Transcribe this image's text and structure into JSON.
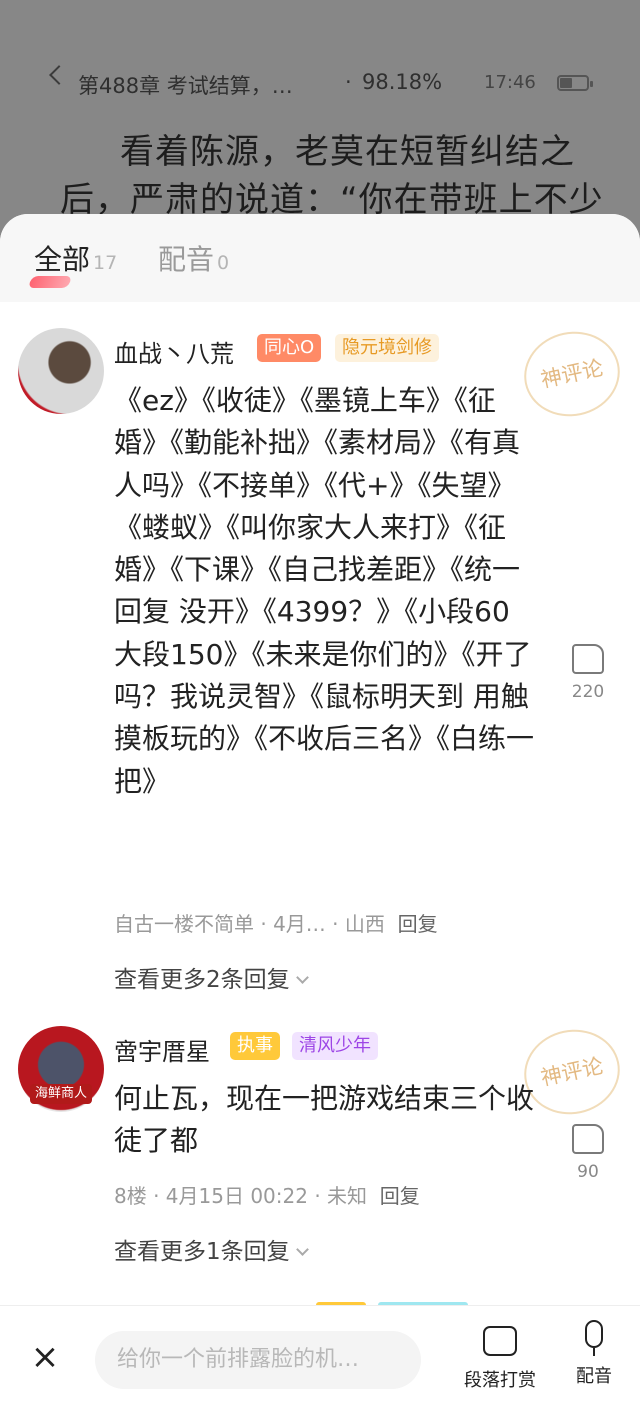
{
  "reader": {
    "chapter": "第488章 考试结算，…",
    "dot": "·",
    "progress": "98.18%",
    "time": "17:46",
    "line1": "看着陈源，老莫在短暂纠结之",
    "line2": "后，严肃的说道：“你在带班上不少"
  },
  "tabs": [
    {
      "label": "全部",
      "count": "17"
    },
    {
      "label": "配音",
      "count": "0"
    }
  ],
  "comments": [
    {
      "name": "血战丶八荒",
      "badges": [
        "同心O",
        "隐元境剑修"
      ],
      "stamp": "神评论",
      "text": "《ez》《收徒》《墨镜上车》《征婚》《勤能补拙》《素材局》《有真人吗》《不接单》《代+》《失望》《蝼蚁》《叫你家大人来打》《征婚》《下课》《自己找差距》《统一回复 没开》《4399？》《小段60大段150》《未来是你们的》《开了吗？我说灵智》《鼠标明天到 用触摸板玩的》《不收后三名》《白练一把》",
      "likes": "220",
      "meta": "自古一楼不简单 · 4月… · 山西",
      "reply": "回复",
      "more": "查看更多2条回复"
    },
    {
      "name": "啻宇厝星",
      "avatar_tag": "海鲜商人",
      "badges": [
        "执事",
        "清风少年"
      ],
      "stamp": "神评论",
      "text": "何止瓦，现在一把游戏结束三个收徒了都",
      "likes": "90",
      "meta": "8楼 · 4月15日 00:22 · 未知",
      "reply": "回复",
      "more": "查看更多1条回复"
    }
  ],
  "bottom": {
    "close": "×",
    "placeholder": "给你一个前排露脸的机…",
    "tip": "段落打赏",
    "voice": "配音"
  },
  "colors": {
    "accent": "#ff4a5a",
    "badge_red": "#ff8a66",
    "badge_purple": "#9d45e6"
  }
}
